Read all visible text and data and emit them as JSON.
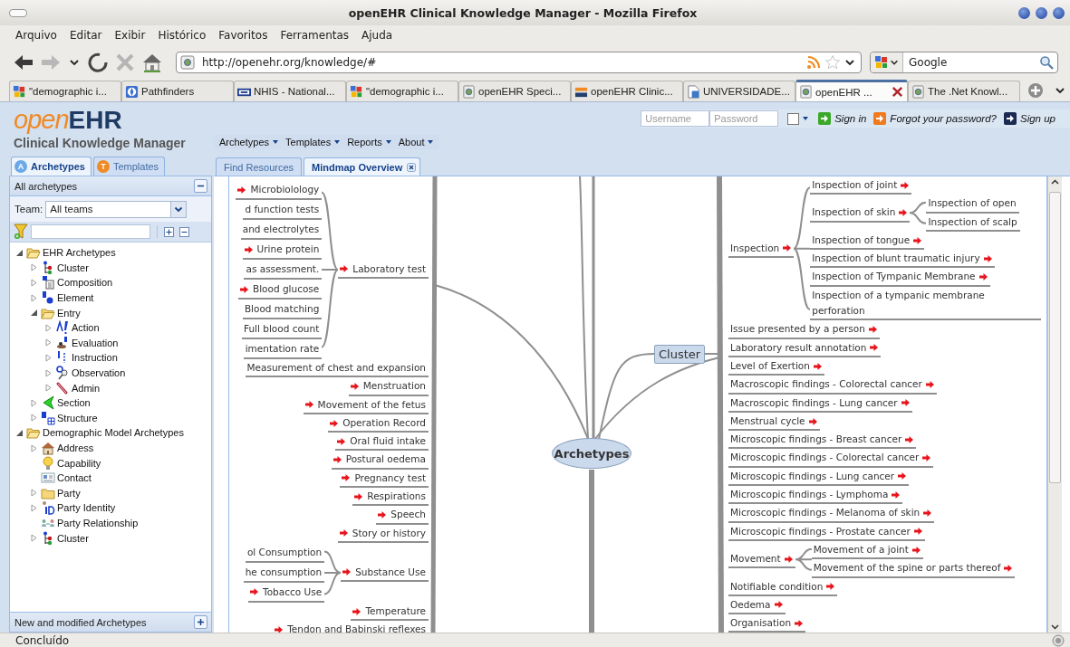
{
  "window": {
    "title": "openEHR Clinical Knowledge Manager - Mozilla Firefox"
  },
  "menu": [
    "Arquivo",
    "Editar",
    "Exibir",
    "Histórico",
    "Favoritos",
    "Ferramentas",
    "Ajuda"
  ],
  "address_bar": {
    "url": "http://openehr.org/knowledge/#"
  },
  "search": {
    "placeholder": "Google"
  },
  "browser_tabs": [
    {
      "title": "\"demographic i...",
      "kind": "google",
      "selected": false
    },
    {
      "title": "Pathfinders",
      "kind": "compass",
      "selected": false
    },
    {
      "title": "NHIS - National...",
      "kind": "cdc",
      "selected": false
    },
    {
      "title": "\"demographic i...",
      "kind": "google",
      "selected": false
    },
    {
      "title": "openEHR Speci...",
      "kind": "page",
      "selected": false
    },
    {
      "title": "openEHR Clinic...",
      "kind": "ehr",
      "selected": false
    },
    {
      "title": "UNIVERSIDADE...",
      "kind": "doc",
      "selected": false
    },
    {
      "title": "openEHR ...",
      "kind": "page",
      "selected": true
    },
    {
      "title": "The .Net Knowl...",
      "kind": "page",
      "selected": false
    }
  ],
  "logo": {
    "part_1": "open",
    "part_2": "EHR"
  },
  "subtitle": "Clinical Knowledge Manager",
  "login": {
    "username_placeholder": "Username",
    "password_placeholder": "Password",
    "remember": false,
    "links": [
      {
        "label": "Sign in",
        "kind": "signin"
      },
      {
        "label": "Forgot your password?",
        "kind": "forgot"
      },
      {
        "label": "Sign up",
        "kind": "signup"
      }
    ]
  },
  "nav_menu": [
    "Archetypes",
    "Templates",
    "Reports",
    "About"
  ],
  "side_tabs": [
    {
      "label": "Archetypes",
      "badge": "A",
      "kind": "archetype",
      "selected": true
    },
    {
      "label": "Templates",
      "badge": "T",
      "kind": "template",
      "selected": false
    }
  ],
  "panel": {
    "title": "All archetypes",
    "team_label": "Team:",
    "team_value": "All teams",
    "footer": "New and modified Archetypes"
  },
  "tree": [
    {
      "label": "EHR Archetypes",
      "kind": "folder",
      "has_children": true,
      "expanded": true,
      "children": [
        {
          "label": "Cluster",
          "kind": "cluster",
          "has_children": true,
          "expanded": false
        },
        {
          "label": "Composition",
          "kind": "composition",
          "has_children": true,
          "expanded": false
        },
        {
          "label": "Element",
          "kind": "element",
          "has_children": true,
          "expanded": false
        },
        {
          "label": "Entry",
          "kind": "folder",
          "has_children": true,
          "expanded": true,
          "children": [
            {
              "label": "Action",
              "kind": "action",
              "has_children": true,
              "expanded": false
            },
            {
              "label": "Evaluation",
              "kind": "evaluation",
              "has_children": true,
              "expanded": false
            },
            {
              "label": "Instruction",
              "kind": "instruction",
              "has_children": true,
              "expanded": false
            },
            {
              "label": "Observation",
              "kind": "observation",
              "has_children": true,
              "expanded": false
            },
            {
              "label": "Admin",
              "kind": "admin",
              "has_children": true,
              "expanded": false
            }
          ]
        },
        {
          "label": "Section",
          "kind": "section",
          "has_children": true,
          "expanded": false
        },
        {
          "label": "Structure",
          "kind": "structure",
          "has_children": true,
          "expanded": false
        }
      ]
    },
    {
      "label": "Demographic Model Archetypes",
      "kind": "folder",
      "has_children": true,
      "expanded": true,
      "children": [
        {
          "label": "Address",
          "kind": "address",
          "has_children": true,
          "expanded": false
        },
        {
          "label": "Capability",
          "kind": "capability",
          "has_children": false
        },
        {
          "label": "Contact",
          "kind": "contact",
          "has_children": false
        },
        {
          "label": "Party",
          "kind": "folder",
          "has_children": true,
          "expanded": false
        },
        {
          "label": "Party Identity",
          "kind": "identity",
          "has_children": true,
          "expanded": false
        },
        {
          "label": "Party Relationship",
          "kind": "relationship",
          "has_children": false
        },
        {
          "label": "Cluster",
          "kind": "cluster",
          "has_children": true,
          "expanded": false
        }
      ]
    }
  ],
  "content_tabs": [
    {
      "label": "Find Resources",
      "selected": false,
      "closable": false
    },
    {
      "label": "Mindmap Overview",
      "selected": true,
      "closable": true
    }
  ],
  "mindmap": {
    "root": "Archetypes",
    "branch": "Cluster",
    "left": [
      {
        "label": "Laboratory test",
        "arrow": true,
        "children": [
          {
            "label": "Microbiolology",
            "arrow": true
          },
          {
            "label": "d function tests",
            "arrow": false
          },
          {
            "label": "and electrolytes",
            "arrow": false
          },
          {
            "label": "Urine protein",
            "arrow": true
          },
          {
            "label": "as assessment.",
            "arrow": false
          },
          {
            "label": "Blood glucose",
            "arrow": true
          },
          {
            "label": "Blood matching",
            "arrow": false
          },
          {
            "label": "Full blood count",
            "arrow": false
          },
          {
            "label": "imentation rate",
            "arrow": false
          }
        ]
      },
      {
        "label": "Measurement of chest and expansion",
        "arrow": false
      },
      {
        "label": "Menstruation",
        "arrow": true
      },
      {
        "label": "Movement of the fetus",
        "arrow": true
      },
      {
        "label": "Operation Record",
        "arrow": true
      },
      {
        "label": "Oral fluid intake",
        "arrow": true
      },
      {
        "label": "Postural oedema",
        "arrow": true
      },
      {
        "label": "Pregnancy test",
        "arrow": true
      },
      {
        "label": "Respirations",
        "arrow": true
      },
      {
        "label": "Speech",
        "arrow": true
      },
      {
        "label": "Story or history",
        "arrow": true
      },
      {
        "label": "Substance Use",
        "arrow": true,
        "children": [
          {
            "label": "ol Consumption",
            "arrow": false
          },
          {
            "label": "he consumption",
            "arrow": false
          },
          {
            "label": "Tobacco Use",
            "arrow": true
          }
        ]
      },
      {
        "label": "Temperature",
        "arrow": true
      },
      {
        "label": "Tendon and Babinski reflexes",
        "arrow": true
      }
    ],
    "right": [
      {
        "label": "Inspection",
        "arrow": true,
        "children": [
          {
            "label": "Inspection of joint",
            "arrow": true
          },
          {
            "label": "Inspection of skin",
            "arrow": true,
            "children": [
              {
                "label": "Inspection of open",
                "arrow": false
              },
              {
                "label": "Inspection of scalp",
                "arrow": false
              }
            ]
          },
          {
            "label": "Inspection of tongue",
            "arrow": true
          },
          {
            "label": "Inspection of blunt traumatic injury",
            "arrow": true
          },
          {
            "label": "Inspection of Tympanic Membrane",
            "arrow": true
          },
          {
            "label": "Inspection of a tympanic membrane perforation",
            "arrow": false
          }
        ]
      },
      {
        "label": "Issue presented by a person",
        "arrow": true
      },
      {
        "label": "Laboratory result annotation",
        "arrow": true
      },
      {
        "label": "Level of Exertion",
        "arrow": true
      },
      {
        "label": "Macroscopic findings - Colorectal cancer",
        "arrow": true
      },
      {
        "label": "Macroscopic findings - Lung cancer",
        "arrow": true
      },
      {
        "label": "Menstrual cycle",
        "arrow": true
      },
      {
        "label": "Microscopic findings - Breast cancer",
        "arrow": true
      },
      {
        "label": "Microscopic findings - Colorectal cancer",
        "arrow": true
      },
      {
        "label": "Microscopic findings - Lung cancer",
        "arrow": true
      },
      {
        "label": "Microscopic findings - Lymphoma",
        "arrow": true
      },
      {
        "label": "Microscopic findings - Melanoma of skin",
        "arrow": true
      },
      {
        "label": "Microscopic findings - Prostate cancer",
        "arrow": true
      },
      {
        "label": "Movement",
        "arrow": true,
        "children": [
          {
            "label": "Movement of a joint",
            "arrow": true
          },
          {
            "label": "Movement of the spine or parts thereof",
            "arrow": true
          }
        ]
      },
      {
        "label": "Notifiable condition",
        "arrow": true
      },
      {
        "label": "Oedema",
        "arrow": true
      },
      {
        "label": "Organisation",
        "arrow": true
      }
    ]
  },
  "status_bar": "Concluído"
}
